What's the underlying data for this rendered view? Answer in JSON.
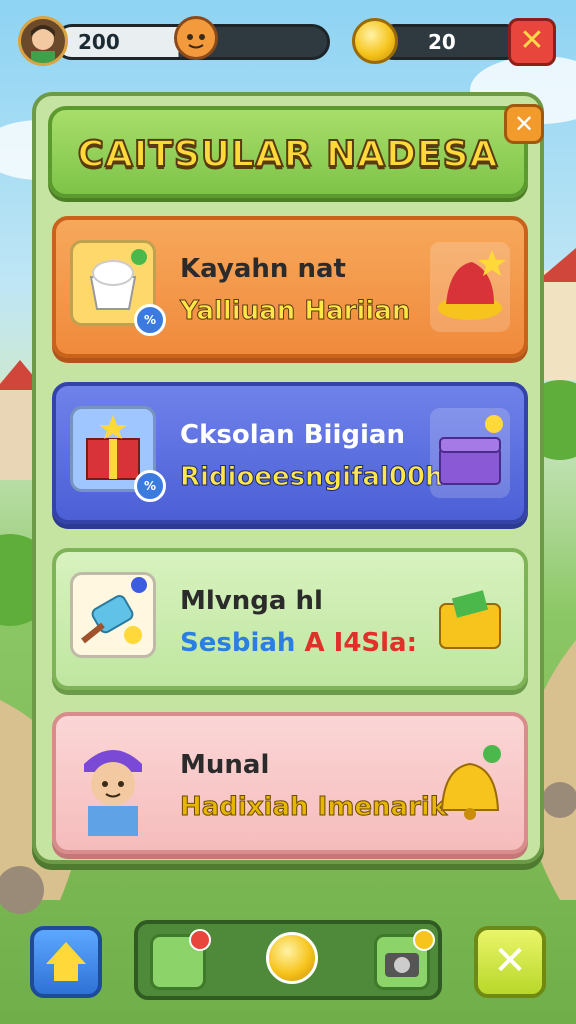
{
  "hud": {
    "player_value": "200",
    "coin_value": "20"
  },
  "panel": {
    "title": "CAITSULAR NADESA"
  },
  "cards": [
    {
      "title": "Kayahn nat",
      "subtitle": "Yalliuan Hariian",
      "badge": "%"
    },
    {
      "title": "Cksolan Biigian",
      "subtitle": "Ridioeesngifal00h",
      "badge": "%"
    },
    {
      "title": "Mlvnga hl",
      "subtitle_main": "Sesbiah",
      "subtitle_accent": "A I4Sla:"
    },
    {
      "title": "Munal",
      "subtitle": "Hadixiah Imenarik"
    }
  ],
  "colors": {
    "accent_title": "#ffd93a",
    "card1": "#f08a3c",
    "card2": "#4c5fd6",
    "card3": "#bfe6a0",
    "card4": "#f6bcbc"
  }
}
